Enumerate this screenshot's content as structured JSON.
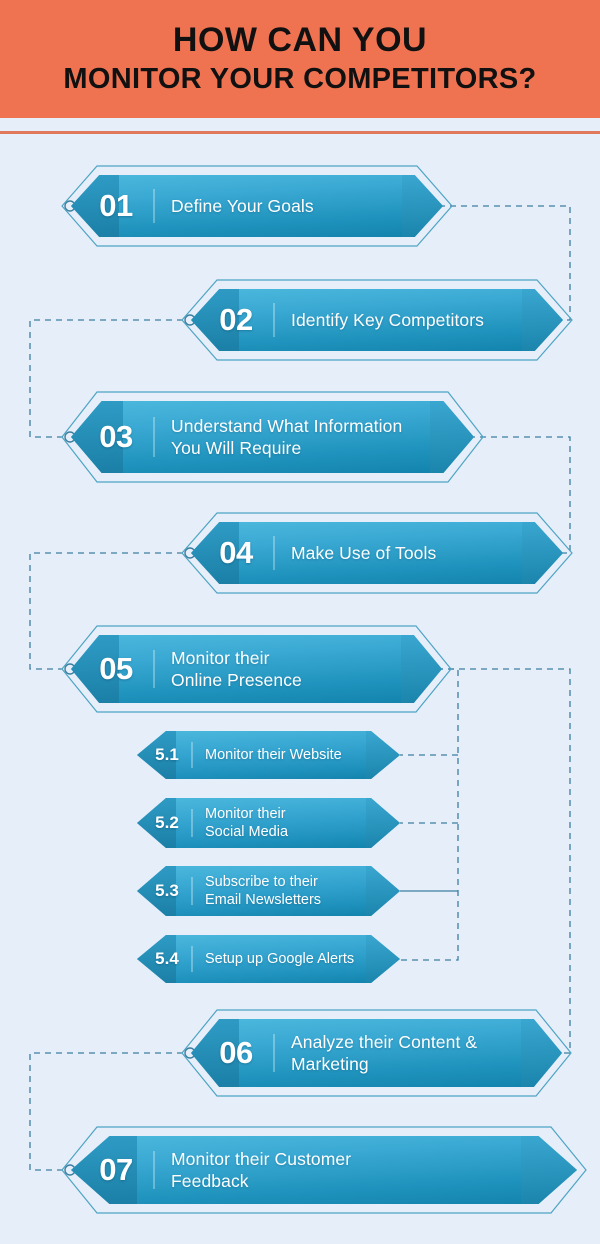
{
  "colors": {
    "header_bg": "#f07351",
    "page_bg": "#e6eff9",
    "rule": "#e0785c",
    "node_light": "#4cb8dd",
    "node_dark": "#1282ab",
    "wire": "#3d7fa0",
    "title_text": "#111111",
    "node_text": "#ffffff"
  },
  "header": {
    "title_line1": "HOW CAN YOU",
    "title_line2": "MONITOR YOUR COMPETITORS?"
  },
  "steps": [
    {
      "number": "01",
      "label": "Define Your Goals",
      "align": "left"
    },
    {
      "number": "02",
      "label": "Identify Key Competitors",
      "align": "right"
    },
    {
      "number": "03",
      "label": "Understand What Information\nYou Will Require",
      "align": "left"
    },
    {
      "number": "04",
      "label": "Make Use of Tools",
      "align": "right"
    },
    {
      "number": "05",
      "label": "Monitor their\nOnline Presence",
      "align": "left"
    },
    {
      "number": "06",
      "label": "Analyze their Content &\nMarketing",
      "align": "right"
    },
    {
      "number": "07",
      "label": "Monitor their Customer\nFeedback",
      "align": "left"
    }
  ],
  "substeps": [
    {
      "number": "5.1",
      "label": "Monitor their Website"
    },
    {
      "number": "5.2",
      "label": "Monitor their\nSocial Media"
    },
    {
      "number": "5.3",
      "label": "Subscribe to their\nEmail Newsletters"
    },
    {
      "number": "5.4",
      "label": "Setup up Google Alerts"
    }
  ]
}
